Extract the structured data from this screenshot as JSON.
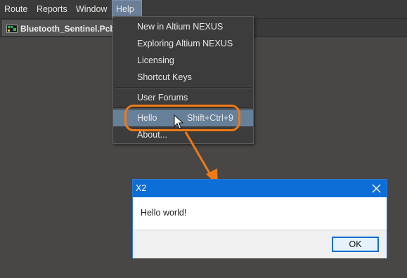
{
  "menubar": {
    "items": [
      {
        "label": "Route"
      },
      {
        "label": "Reports"
      },
      {
        "label": "Window"
      },
      {
        "label": "Help",
        "active": true
      }
    ]
  },
  "tabs": {
    "document": {
      "label": "Bluetooth_Sentinel.PcbDoc",
      "icon": "pcb-document-icon"
    }
  },
  "help_menu": {
    "items": [
      {
        "label": "New in Altium NEXUS"
      },
      {
        "label": "Exploring Altium NEXUS"
      },
      {
        "label": "Licensing"
      },
      {
        "label": "Shortcut Keys"
      },
      {
        "label": "User Forums"
      },
      {
        "label": "Hello",
        "shortcut": "Shift+Ctrl+9",
        "highlighted": true
      },
      {
        "label": "About..."
      }
    ]
  },
  "dialog": {
    "title": "X2",
    "message": "Hello world!",
    "ok_label": "OK",
    "close_icon": "close-icon"
  },
  "annotation": {
    "color": "#ee7a16"
  },
  "colors": {
    "menu_highlight": "#66809a",
    "dialog_titlebar": "#0d6ed8",
    "workspace": "#484746"
  }
}
